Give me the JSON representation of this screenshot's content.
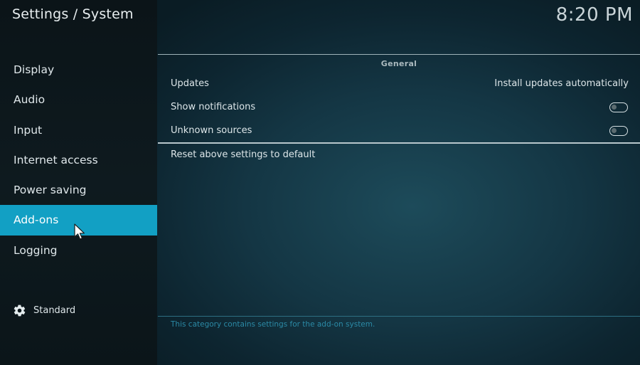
{
  "header": {
    "title": "Settings / System",
    "clock": "8:20 PM"
  },
  "sidebar": {
    "items": [
      {
        "label": "Display"
      },
      {
        "label": "Audio"
      },
      {
        "label": "Input"
      },
      {
        "label": "Internet access"
      },
      {
        "label": "Power saving"
      },
      {
        "label": "Add-ons"
      },
      {
        "label": "Logging"
      }
    ],
    "active_item": "Add-ons",
    "settings_level": {
      "icon": "gear-icon",
      "label": "Standard"
    }
  },
  "main": {
    "group_title": "General",
    "settings": [
      {
        "label": "Updates",
        "value": "Install updates automatically"
      },
      {
        "label": "Show notifications",
        "toggle": false
      },
      {
        "label": "Unknown sources",
        "toggle": false
      }
    ],
    "reset_label": "Reset above settings to default",
    "description": "This category contains settings for the add-on system."
  },
  "colors": {
    "accent": "#12a0c4",
    "description_text": "#2b8aa6"
  }
}
